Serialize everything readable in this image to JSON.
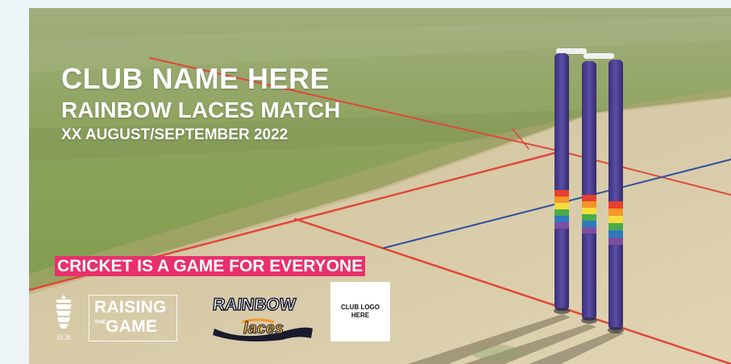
{
  "poster": {
    "club_name": "CLUB NAME HERE",
    "match_title": "RAINBOW LACES MATCH",
    "match_date": "XX AUGUST/SEPTEMBER 2022",
    "slogan": "CRICKET IS A GAME FOR EVERYONE"
  },
  "logos": {
    "ecb_text": "ECB",
    "raising_top": "RAISING",
    "raising_the": "THE",
    "raising_bottom": "GAME",
    "rainbow_word": "RAINBOW",
    "laces_word": "laces",
    "club_logo_text": "CLUB LOGO HERE"
  },
  "colors": {
    "slogan_background": "#e8306b",
    "stump_purple": "#4b3f8f",
    "grass": "#7fa04e",
    "pitch": "#d6c9a6",
    "crease_red": "#e0483a",
    "crease_blue": "#2f4fa0"
  },
  "icons": {
    "ecb": "ecb-crest-icon",
    "stumps": "cricket-stumps-icon"
  }
}
